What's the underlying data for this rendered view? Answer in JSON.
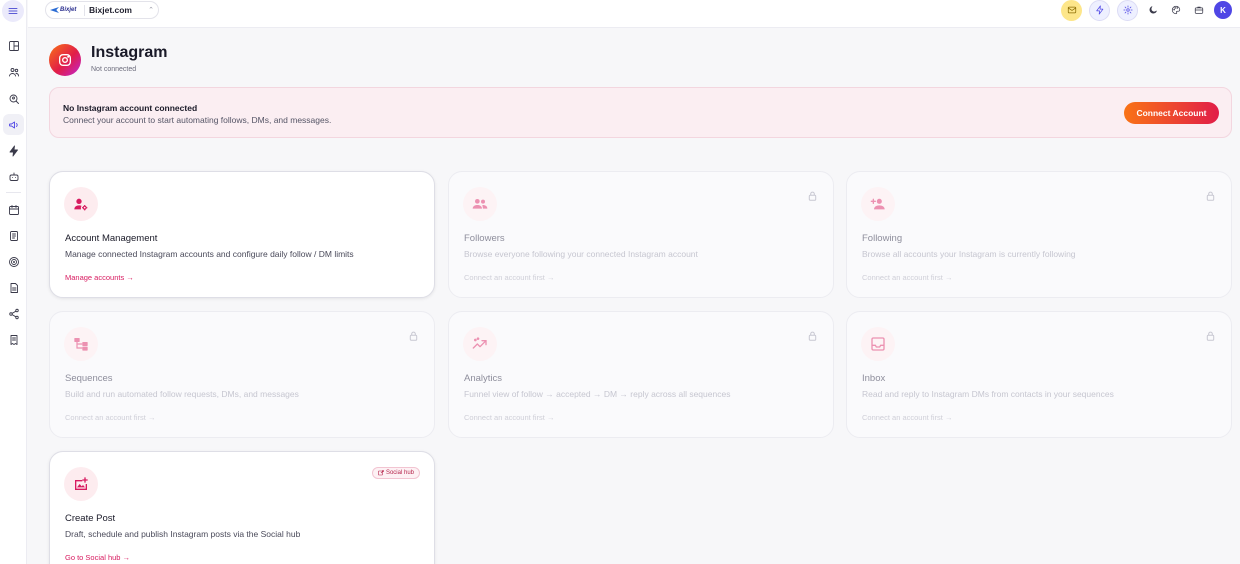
{
  "workspace": {
    "logo_text": "Bixjet",
    "name": "Bixjet.com",
    "chevron": "⌃"
  },
  "user": {
    "avatar_initial": "K"
  },
  "page": {
    "title": "Instagram",
    "subtitle": "Not connected"
  },
  "banner": {
    "title": "No Instagram account connected",
    "text": "Connect your account to start automating follows, DMs, and messages.",
    "button_label": "Connect Account"
  },
  "cards": [
    {
      "title": "Account Management",
      "desc": "Manage connected Instagram accounts and configure daily follow / DM limits",
      "link": "Manage accounts →",
      "icon": "user-settings-icon",
      "locked": false
    },
    {
      "title": "Followers",
      "desc": "Browse everyone following your connected Instagram account",
      "link": "Connect an account first →",
      "icon": "users-icon",
      "locked": true
    },
    {
      "title": "Following",
      "desc": "Browse all accounts your Instagram is currently following",
      "link": "Connect an account first →",
      "icon": "user-plus-icon",
      "locked": true
    },
    {
      "title": "Sequences",
      "desc": "Build and run automated follow requests, DMs, and messages",
      "link": "Connect an account first →",
      "icon": "flow-icon",
      "locked": true
    },
    {
      "title": "Analytics",
      "desc": "Funnel view of follow → accepted → DM → reply across all sequences",
      "link": "Connect an account first →",
      "icon": "trend-icon",
      "locked": true
    },
    {
      "title": "Inbox",
      "desc": "Read and reply to Instagram DMs from contacts in your sequences",
      "link": "Connect an account first →",
      "icon": "inbox-icon",
      "locked": true
    },
    {
      "title": "Create Post",
      "desc": "Draft, schedule and publish Instagram posts via the Social hub",
      "link": "Go to Social hub →",
      "icon": "image-plus-icon",
      "locked": false,
      "tag": "Social hub"
    }
  ],
  "colors": {
    "accent": "#d81b60",
    "brand": "#4f46e5",
    "banner_bg": "#fbeef2"
  }
}
